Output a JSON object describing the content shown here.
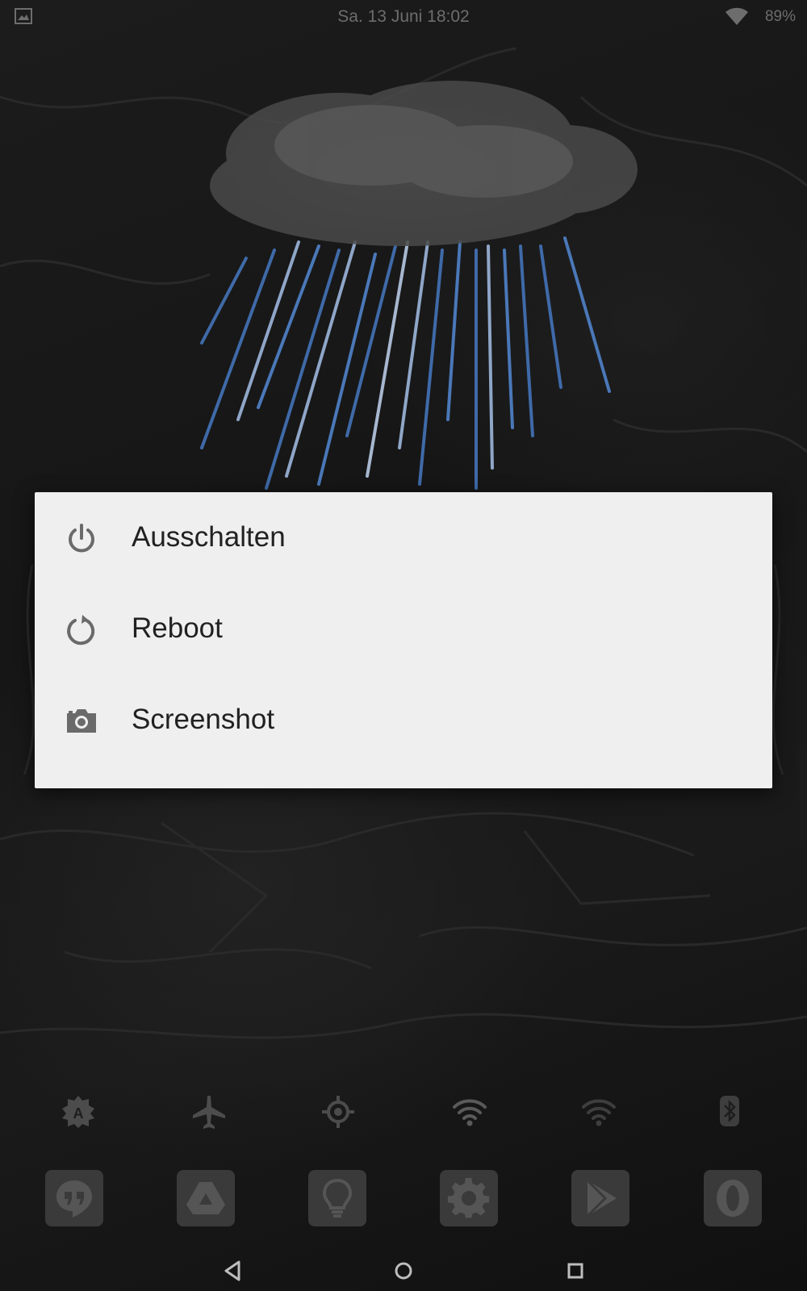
{
  "status_bar": {
    "datetime": "Sa. 13 Juni 18:02",
    "battery": "89%",
    "icons": [
      "gallery-icon",
      "wifi-icon"
    ]
  },
  "power_menu": {
    "items": [
      {
        "label": "Ausschalten",
        "icon": "power-icon"
      },
      {
        "label": "Reboot",
        "icon": "reboot-icon"
      },
      {
        "label": "Screenshot",
        "icon": "camera-icon"
      }
    ]
  },
  "quick_settings": {
    "icons": [
      "auto-brightness-icon",
      "airplane-mode-icon",
      "location-icon",
      "wifi-icon",
      "wifi-hotspot-icon",
      "bluetooth-icon"
    ]
  },
  "dock": {
    "apps": [
      "hangouts-icon",
      "google-drive-icon",
      "lightbulb-icon",
      "settings-icon",
      "play-store-icon",
      "opera-icon"
    ]
  },
  "nav_bar": {
    "buttons": [
      "back-button",
      "home-button",
      "recents-button"
    ]
  },
  "colors": {
    "dialog_background": "#efefef",
    "dialog_text": "#212121",
    "icon_gray": "#6a6a6a",
    "rain_blue": "#4a78b8"
  }
}
